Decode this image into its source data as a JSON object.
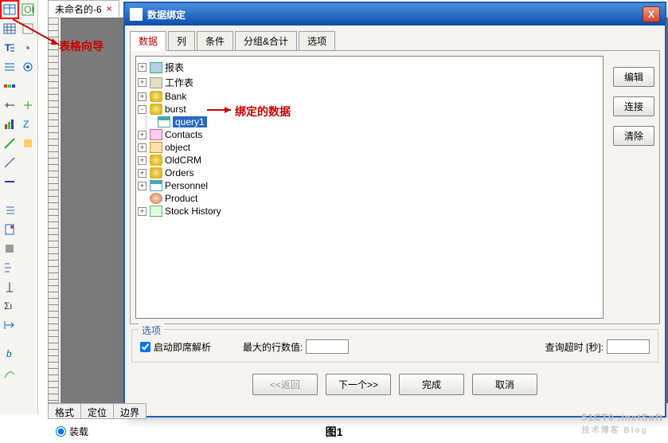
{
  "doc_tab": {
    "title": "未命名的-6",
    "close": "×"
  },
  "annotations": {
    "table_wizard": "表格向导",
    "bound_data": "绑定的数据"
  },
  "dialog": {
    "title": "数据绑定",
    "close": "X",
    "tabs": [
      "数据",
      "列",
      "条件",
      "分组&合计",
      "选项"
    ],
    "tree": {
      "items": [
        {
          "label": "报表",
          "icon": "ic-report",
          "toggle": "+"
        },
        {
          "label": "工作表",
          "icon": "ic-ws",
          "toggle": "+"
        },
        {
          "label": "Bank",
          "icon": "ic-db",
          "toggle": "+"
        },
        {
          "label": "burst",
          "icon": "ic-db",
          "toggle": "-",
          "children": [
            {
              "label": "query1",
              "icon": "ic-table",
              "selected": true
            }
          ]
        },
        {
          "label": "Contacts",
          "icon": "ic-contacts",
          "toggle": "+"
        },
        {
          "label": "object",
          "icon": "ic-obj",
          "toggle": "+"
        },
        {
          "label": "OldCRM",
          "icon": "ic-db",
          "toggle": "+"
        },
        {
          "label": "Orders",
          "icon": "ic-db",
          "toggle": "+"
        },
        {
          "label": "Personnel",
          "icon": "ic-table",
          "toggle": "+"
        },
        {
          "label": "Product",
          "icon": "ic-prod",
          "toggle": ""
        },
        {
          "label": "Stock History",
          "icon": "ic-stock",
          "toggle": "+"
        }
      ]
    },
    "side_buttons": {
      "edit": "编辑",
      "connect": "连接",
      "clear": "清除"
    },
    "options": {
      "legend": "选项",
      "adhoc": "启动即席解析",
      "max_rows": "最大的行数值:",
      "timeout": "查询超时 [秒]:"
    },
    "buttons": {
      "back": "<<返回",
      "next": "下一个>>",
      "finish": "完成",
      "cancel": "取消"
    }
  },
  "bottom_tabs": [
    "格式",
    "定位",
    "边界"
  ],
  "bottom_radio": "装载",
  "figure": "图1",
  "watermark": {
    "line1": "51CT0 .inetSoft",
    "line2": "技术博客 Blog"
  }
}
